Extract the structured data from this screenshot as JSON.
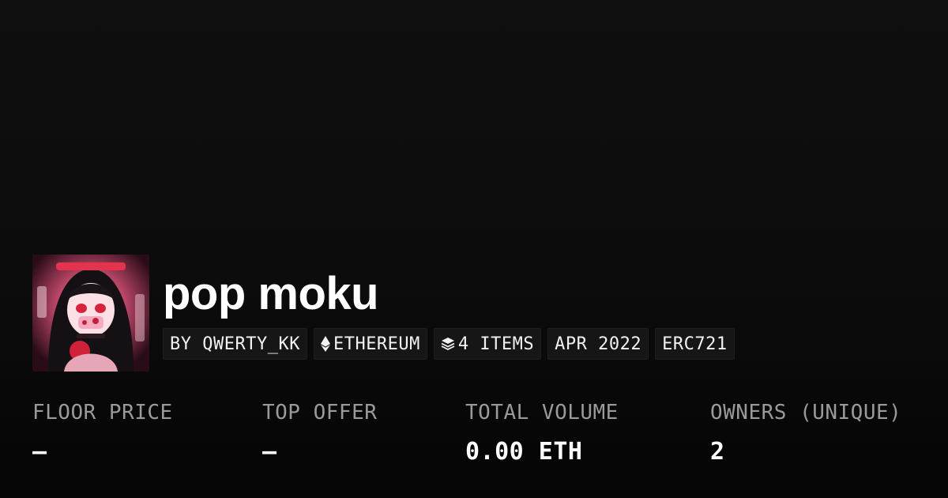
{
  "collection": {
    "title": "pop moku"
  },
  "chips": [
    {
      "icon": "",
      "label": "BY QWERTY_KK"
    },
    {
      "icon": "ethereum-icon",
      "label": "ETHEREUM"
    },
    {
      "icon": "layers-icon",
      "label": "4 ITEMS"
    },
    {
      "icon": "",
      "label": "APR 2022"
    },
    {
      "icon": "",
      "label": "ERC721"
    }
  ],
  "stats": [
    {
      "label": "FLOOR PRICE",
      "value": "—"
    },
    {
      "label": "TOP OFFER",
      "value": "—"
    },
    {
      "label": "TOTAL VOLUME",
      "value": "0.00 ETH"
    },
    {
      "label": "OWNERS (UNIQUE)",
      "value": "2"
    }
  ]
}
